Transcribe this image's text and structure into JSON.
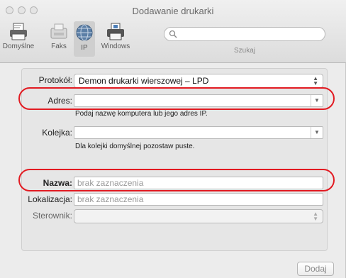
{
  "window": {
    "title": "Dodawanie drukarki"
  },
  "toolbar": {
    "items": [
      {
        "label": "Domyślne",
        "icon": "printer-default-icon"
      },
      {
        "label": "Faks",
        "icon": "fax-icon"
      },
      {
        "label": "IP",
        "icon": "globe-icon"
      },
      {
        "label": "Windows",
        "icon": "windows-printer-icon"
      }
    ],
    "search": {
      "placeholder": "",
      "label": "Szukaj"
    }
  },
  "form": {
    "protocol": {
      "label": "Protokół:",
      "value": "Demon drukarki wierszowej – LPD"
    },
    "address": {
      "label": "Adres:",
      "value": "",
      "hint": "Podaj nazwę komputera lub jego adres IP."
    },
    "queue": {
      "label": "Kolejka:",
      "value": "",
      "hint": "Dla kolejki domyślnej pozostaw puste."
    },
    "name": {
      "label": "Nazwa:",
      "placeholder": "brak zaznaczenia"
    },
    "location": {
      "label": "Lokalizacja:",
      "placeholder": "brak zaznaczenia"
    },
    "driver": {
      "label": "Sterownik:",
      "value": ""
    }
  },
  "buttons": {
    "add": "Dodaj"
  },
  "colors": {
    "highlight": "#e21b22",
    "window_bg": "#ececec"
  }
}
